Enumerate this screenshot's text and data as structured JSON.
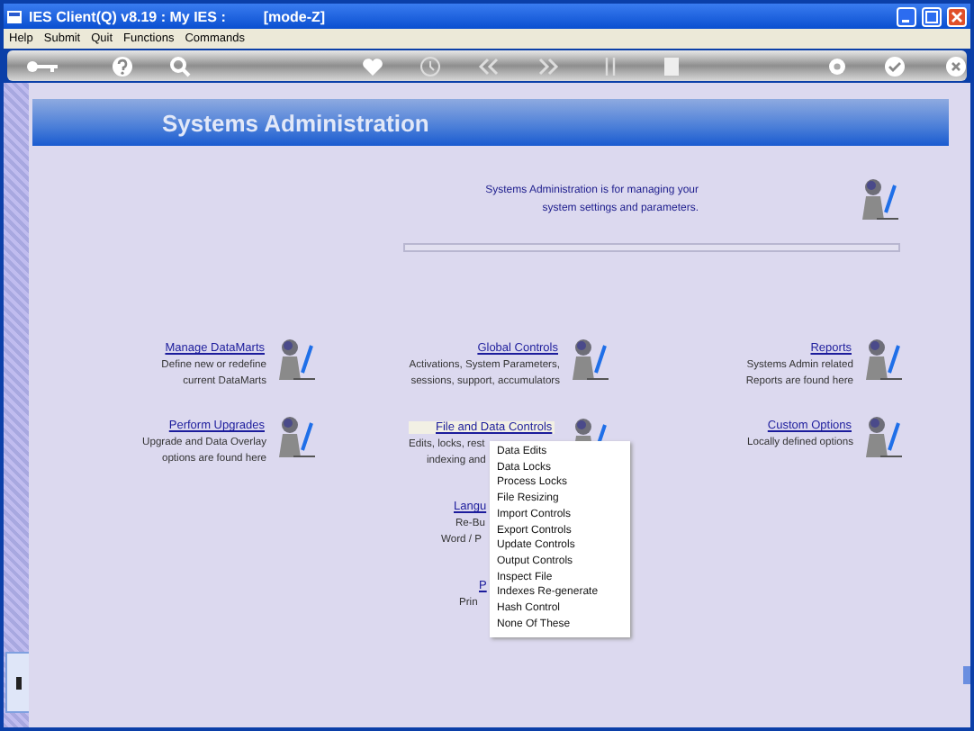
{
  "window": {
    "title": "IES Client(Q) v8.19 : My IES :",
    "mode": "[mode-Z]"
  },
  "menu_bar": [
    "Help",
    "Submit",
    "Quit",
    "Functions",
    "Commands"
  ],
  "page": {
    "title": "Systems Administration",
    "intro": [
      "Systems Administration is for managing your",
      "system settings and parameters."
    ]
  },
  "columns": [
    {
      "items": [
        {
          "heading": "Manage DataMarts",
          "lines": [
            "Define new or redefine",
            "current DataMarts"
          ],
          "icon": true,
          "highlighted": false
        },
        {
          "heading": "Perform Upgrades",
          "lines": [
            "Upgrade and Data Overlay",
            "options are found here"
          ],
          "icon": true,
          "highlighted": false
        }
      ]
    },
    {
      "items": [
        {
          "heading": "Global Controls",
          "lines": [
            "Activations, System Parameters,",
            "sessions, support, accumulators"
          ],
          "icon": true,
          "highlighted": false
        },
        {
          "heading": "File and Data Controls",
          "lines": [
            "Edits, locks, rest",
            "indexing and"
          ],
          "icon": true,
          "highlighted": true
        },
        {
          "heading": "Langu",
          "lines": [
            "Re-Bu",
            "Word / P"
          ],
          "highlighted": false
        },
        {
          "heading": "P",
          "lines": [
            "Prin"
          ],
          "highlighted": false
        }
      ]
    },
    {
      "items": [
        {
          "heading": "Reports",
          "lines": [
            "Systems Admin related",
            "Reports are found here"
          ],
          "icon": true,
          "highlighted": false
        },
        {
          "heading": "Custom Options",
          "lines": [
            "Locally defined options"
          ],
          "icon": true,
          "highlighted": false
        }
      ]
    }
  ],
  "popup_menu": [
    "Data Edits",
    "Data Locks",
    "Process Locks",
    "File Resizing",
    "Import Controls",
    "Export Controls",
    "Update Controls",
    "Output Controls",
    "Inspect File",
    "Indexes Re-generate",
    "Hash Control",
    "None Of These"
  ]
}
